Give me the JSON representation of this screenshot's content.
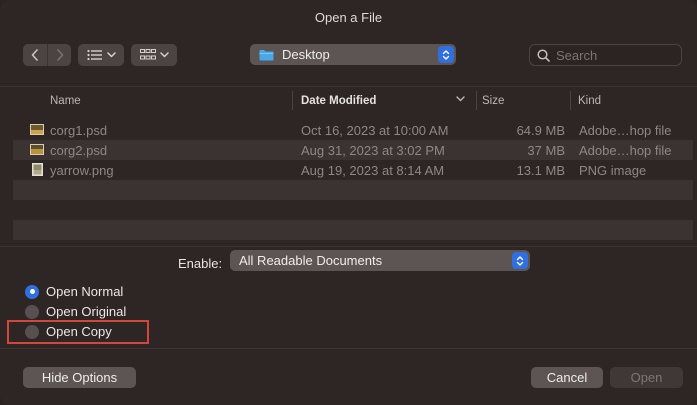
{
  "dialog": {
    "title": "Open a File"
  },
  "toolbar": {
    "back_icon": "chevron-left-icon",
    "forward_icon": "chevron-right-icon",
    "list_view_icon": "list-view-icon",
    "grid_view_icon": "grid-view-icon",
    "location": "Desktop",
    "search_placeholder": "Search"
  },
  "columns": {
    "name": "Name",
    "date_modified": "Date Modified",
    "size": "Size",
    "kind": "Kind"
  },
  "files": [
    {
      "name": "corg1.psd",
      "date": "Oct 16, 2023 at 10:00 AM",
      "size": "64.9 MB",
      "kind": "Adobe…hop file"
    },
    {
      "name": "corg2.psd",
      "date": "Aug 31, 2023 at 3:02 PM",
      "size": "37 MB",
      "kind": "Adobe…hop file"
    },
    {
      "name": "yarrow.png",
      "date": "Aug 19, 2023 at 8:14 AM",
      "size": "13.1 MB",
      "kind": "PNG image"
    }
  ],
  "enable": {
    "label": "Enable:",
    "value": "All Readable Documents"
  },
  "options": {
    "open_normal": "Open Normal",
    "open_original": "Open Original",
    "open_copy": "Open Copy",
    "selected": "Open Normal"
  },
  "buttons": {
    "hide_options": "Hide Options",
    "cancel": "Cancel",
    "open": "Open"
  },
  "colors": {
    "accent": "#2f6fe0",
    "highlight_box": "#d2473c"
  }
}
